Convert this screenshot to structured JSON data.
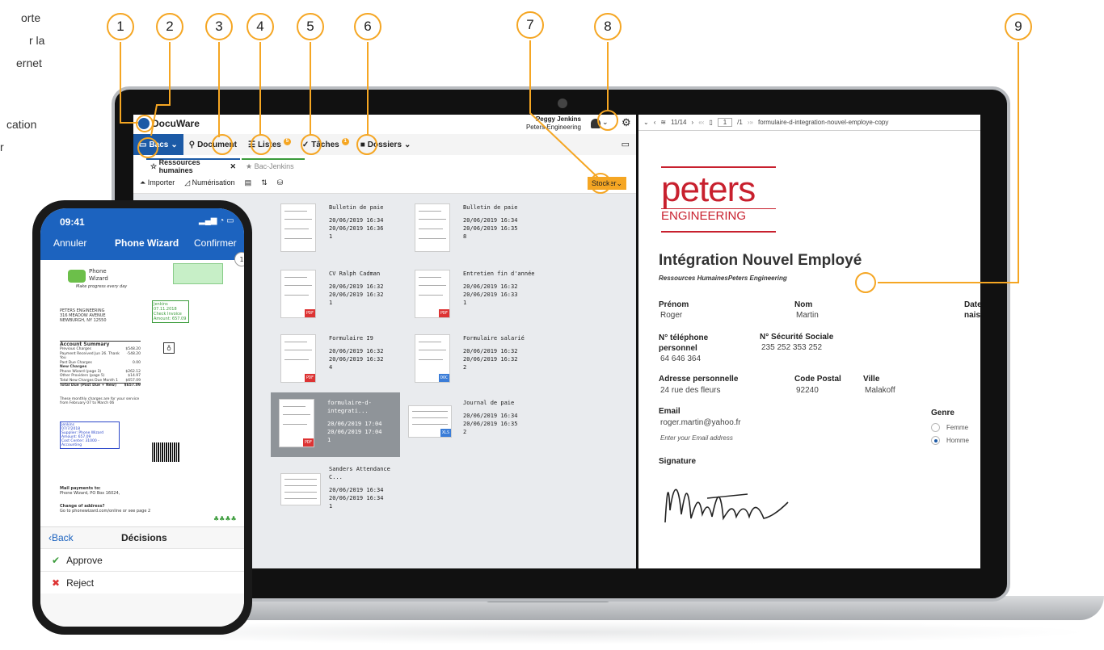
{
  "side_text": [
    "orte",
    "r la",
    "ernet",
    "cation",
    "r"
  ],
  "callouts": [
    "1",
    "2",
    "3",
    "4",
    "5",
    "6",
    "7",
    "8",
    "9"
  ],
  "app": {
    "logo": "DocuWare",
    "user_name": "Peggy Jenkins",
    "user_company": "Peters Engineering",
    "toolbar": {
      "bacs": "Bacs",
      "document": "Document",
      "listes": "Listes",
      "listes_badge": "5",
      "taches": "Tâches",
      "taches_badge": "1",
      "dossiers": "Dossiers"
    },
    "tabs": [
      "Ressources humaines",
      "Bac-Jenkins"
    ],
    "actions": {
      "importer": "Importer",
      "numerisation": "Numérisation",
      "stocker": "Stocker"
    },
    "documents": [
      {
        "title": "Bulletin de paie",
        "d1": "20/06/2019 16:34",
        "d2": "20/06/2019 16:36",
        "n": "1"
      },
      {
        "title": "Bulletin de paie",
        "d1": "20/06/2019 16:34",
        "d2": "20/06/2019 16:35",
        "n": "8"
      },
      {
        "title": "CV Ralph Cadman",
        "d1": "20/06/2019 16:32",
        "d2": "20/06/2019 16:32",
        "n": "1"
      },
      {
        "title": "Entretien fin d'année",
        "d1": "20/06/2019 16:32",
        "d2": "20/06/2019 16:33",
        "n": "1"
      },
      {
        "title": "Formulaire I9",
        "d1": "20/06/2019 16:32",
        "d2": "20/06/2019 16:32",
        "n": "4"
      },
      {
        "title": "Formulaire salarié",
        "d1": "20/06/2019 16:32",
        "d2": "20/06/2019 16:32",
        "n": "2"
      },
      {
        "title": "formulaire-d-integrati...",
        "d1": "20/06/2019 17:04",
        "d2": "20/06/2019 17:04",
        "n": "1"
      },
      {
        "title": "Journal de paie",
        "d1": "20/06/2019 16:34",
        "d2": "20/06/2019 16:35",
        "n": "2"
      },
      {
        "title": "Sanders Attendance C...",
        "d1": "20/06/2019 16:34",
        "d2": "20/06/2019 16:34",
        "n": "1"
      }
    ]
  },
  "viewer": {
    "nav": "11/14",
    "page": "1",
    "page_total": "/1",
    "filename": "formulaire-d-integration-nouvel-employe-copy",
    "logo_top": "peters",
    "logo_bottom": "ENGINEERING",
    "title": "Intégration Nouvel Employé",
    "subtitle": "Ressources HumainesPeters Engineering",
    "fields": {
      "prenom_label": "Prénom",
      "prenom": "Roger",
      "nom_label": "Nom",
      "nom": "Martin",
      "date_label": "Date",
      "naiss_label": "naiss",
      "tel_label": "N° téléphone personnel",
      "tel": "64 646 364",
      "secu_label": "N° Sécurité Sociale",
      "secu": "235 252 353 252",
      "adresse_label": "Adresse personnelle",
      "adresse": "24 rue des fleurs",
      "cp_label": "Code Postal",
      "cp": "92240",
      "ville_label": "Ville",
      "ville": "Malakoff",
      "email_label": "Email",
      "email": "roger.martin@yahoo.fr",
      "email_hint": "Enter your Email address",
      "genre_label": "Genre",
      "femme": "Femme",
      "homme": "Homme",
      "signature_label": "Signature"
    }
  },
  "phone": {
    "time": "09:41",
    "cancel": "Annuler",
    "title": "Phone Wizard",
    "confirm": "Confirmer",
    "page_badge": "1",
    "back": "Back",
    "decisions": "Décisions",
    "approve": "Approve",
    "reject": "Reject",
    "doc": {
      "brand_line1": "Phone",
      "brand_line2": "Wizard",
      "tagline": "Make progress every day",
      "address1": "PETERS ENGINEERING",
      "address2": "316 MEADOW AVENUE",
      "address3": "NEWBURGH, NY 12550",
      "stamp1": "Jenkins",
      "stamp2": "07.11.2018",
      "stamp3": "Check Invoice",
      "stamp4": "Amount: 657.09",
      "summary": "Account Summary",
      "rows": [
        "Previous Charges",
        "Payment Received Jun 26. Thank You",
        "Past Due Charges",
        "New Charges",
        "Phone Wizard (page 3)",
        "Other Providers (page 5)",
        "Total New Charges Due Month 1",
        "Total Due (Past Due + New)"
      ],
      "amounts": [
        "$548.20",
        "-548.20",
        "0.00",
        "",
        "$262.12",
        "$14.97",
        "$657.09",
        "$657.09"
      ],
      "note": "These monthly charges are for your service from February 07 to March 06",
      "box1": "Jenkins",
      "box2": "07/7/2018",
      "box3": "Supplier: Phone Wizard",
      "box4": "Amount: 657.09",
      "box5": "Cost Center: 31000 - Accounting",
      "mail1": "Mail payments to:",
      "mail2": "Phone Wizard, PO Box 16024,",
      "change1": "Change of address?",
      "change2": "Go to phonewizard.com/online or see page 2"
    }
  }
}
